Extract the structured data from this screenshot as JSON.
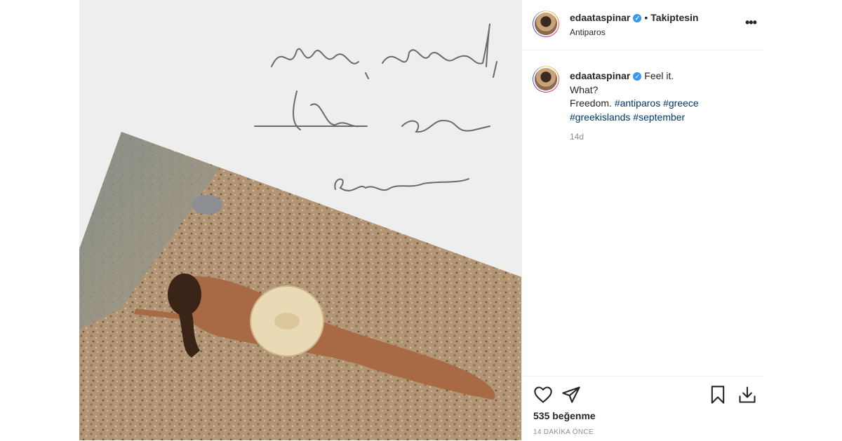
{
  "header": {
    "username": "edaataspinar",
    "separator": "•",
    "follow_status": "Takiptesin",
    "location": "Antiparos",
    "more": "•••"
  },
  "caption": {
    "username": "edaataspinar",
    "line1": "Feel it.",
    "line2": "What?",
    "line3_text": "Freedom.",
    "hashtags": [
      "#antiparos",
      "#greece",
      "#greekislands",
      "#september"
    ],
    "time": "14d"
  },
  "media": {
    "handwriting": [
      "sun, send,",
      "the sea",
      "& me"
    ]
  },
  "actions": {
    "icons": [
      "heart-icon",
      "share-icon",
      "bookmark-icon",
      "download-icon"
    ],
    "likes": "535 beğenme",
    "time_ago": "14 DAKİKA ÖNCE"
  },
  "colors": {
    "link": "#00376b",
    "verified": "#3897f0",
    "muted": "#8e8e8e",
    "border": "#efefef"
  }
}
